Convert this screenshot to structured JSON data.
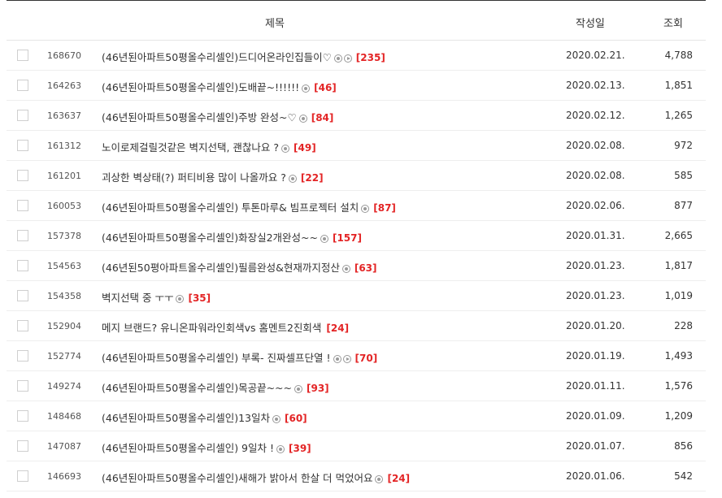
{
  "header": {
    "title": "제목",
    "date": "작성일",
    "views": "조회"
  },
  "posts": [
    {
      "id": "168670",
      "title": "(46년된아파트50평올수리셀인)드디어온라인집들이♡",
      "photo": true,
      "video": true,
      "comments": "[235]",
      "date": "2020.02.21.",
      "views": "4,788"
    },
    {
      "id": "164263",
      "title": "(46년된아파트50평올수리셀인)도배끝~!!!!!!",
      "photo": true,
      "video": false,
      "comments": "[46]",
      "date": "2020.02.13.",
      "views": "1,851"
    },
    {
      "id": "163637",
      "title": "(46년된아파트50평올수리셀인)주방 완성~♡",
      "photo": true,
      "video": false,
      "comments": "[84]",
      "date": "2020.02.12.",
      "views": "1,265"
    },
    {
      "id": "161312",
      "title": "노이로제걸릴것같은 벽지선택, 괜찮나요 ?",
      "photo": true,
      "video": false,
      "comments": "[49]",
      "date": "2020.02.08.",
      "views": "972"
    },
    {
      "id": "161201",
      "title": "괴상한 벽상태(?) 퍼티비용 많이 나올까요 ?",
      "photo": true,
      "video": false,
      "comments": "[22]",
      "date": "2020.02.08.",
      "views": "585"
    },
    {
      "id": "160053",
      "title": "(46년된아파트50평올수리셀인) 투톤마루& 빔프로젝터 설치",
      "photo": true,
      "video": false,
      "comments": "[87]",
      "date": "2020.02.06.",
      "views": "877"
    },
    {
      "id": "157378",
      "title": "(46년된아파트50평올수리셀인)화장실2개완성~~",
      "photo": true,
      "video": false,
      "comments": "[157]",
      "date": "2020.01.31.",
      "views": "2,665"
    },
    {
      "id": "154563",
      "title": "(46년된50평아파트올수리셀인)필름완성&현재까지정산",
      "photo": true,
      "video": false,
      "comments": "[63]",
      "date": "2020.01.23.",
      "views": "1,817"
    },
    {
      "id": "154358",
      "title": "벽지선택 중 ㅜㅜ",
      "photo": true,
      "video": false,
      "comments": "[35]",
      "date": "2020.01.23.",
      "views": "1,019"
    },
    {
      "id": "152904",
      "title": "메지 브랜드? 유니온파워라인회색vs 홈멘트2진회색",
      "photo": false,
      "video": false,
      "comments": "[24]",
      "date": "2020.01.20.",
      "views": "228"
    },
    {
      "id": "152774",
      "title": "(46년된아파트50평올수리셀인) 부록- 진짜셀프단열 !",
      "photo": true,
      "video": true,
      "comments": "[70]",
      "date": "2020.01.19.",
      "views": "1,493"
    },
    {
      "id": "149274",
      "title": "(46년된아파트50평올수리셀인)목공끝~~~",
      "photo": true,
      "video": false,
      "comments": "[93]",
      "date": "2020.01.11.",
      "views": "1,576"
    },
    {
      "id": "148468",
      "title": "(46년된아파트50평올수리셀인)13일차",
      "photo": true,
      "video": false,
      "comments": "[60]",
      "date": "2020.01.09.",
      "views": "1,209"
    },
    {
      "id": "147087",
      "title": "(46년된아파트50평올수리셀인) 9일차 !",
      "photo": true,
      "video": false,
      "comments": "[39]",
      "date": "2020.01.07.",
      "views": "856"
    },
    {
      "id": "146693",
      "title": "(46년된아파트50평올수리셀인)새해가 밝아서 한살 더 먹었어요",
      "photo": true,
      "video": false,
      "comments": "[24]",
      "date": "2020.01.06.",
      "views": "542"
    }
  ]
}
